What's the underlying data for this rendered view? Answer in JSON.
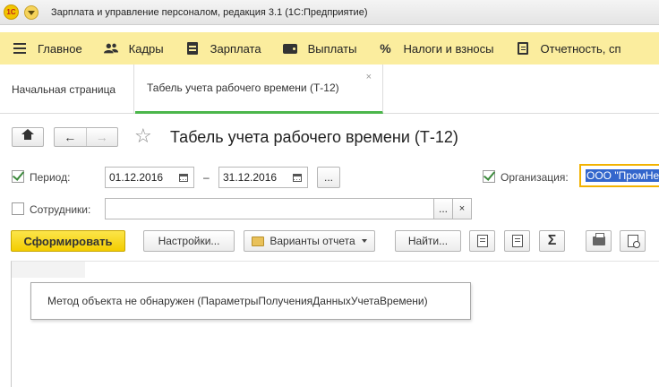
{
  "window": {
    "title": "Зарплата и управление персоналом, редакция 3.1  (1С:Предприятие)",
    "logo_text": "1С"
  },
  "sections": [
    {
      "label": "Главное",
      "icon": "menu-icon"
    },
    {
      "label": "Кадры",
      "icon": "people-icon"
    },
    {
      "label": "Зарплата",
      "icon": "calculator-icon"
    },
    {
      "label": "Выплаты",
      "icon": "wallet-icon"
    },
    {
      "label": "Налоги и взносы",
      "icon": "percent-icon"
    },
    {
      "label": "Отчетность, сп",
      "icon": "reports-icon"
    }
  ],
  "tabs": {
    "home": "Начальная страница",
    "active": "Табель учета рабочего времени (Т-12)",
    "close_glyph": "×"
  },
  "form": {
    "title": "Табель учета рабочего времени (Т-12)",
    "period_label": "Период:",
    "period_from": "01.12.2016",
    "period_dash": "–",
    "period_to": "31.12.2016",
    "ellipsis": "...",
    "organization_label": "Организация:",
    "organization_value": "ООО \"ПромНе",
    "employees_label": "Сотрудники:",
    "employees_value": "",
    "clear_glyph": "×",
    "period_checked": true,
    "organization_checked": true,
    "employees_checked": false
  },
  "commands": {
    "generate": "Сформировать",
    "settings": "Настройки...",
    "variants": "Варианты отчета",
    "find": "Найти...",
    "sum_glyph": "Σ"
  },
  "report": {
    "message": "Метод объекта не обнаружен (ПараметрыПолученияДанныхУчетаВремени)"
  },
  "colors": {
    "section_bar": "#fbed9e",
    "primary_button": "#f3cd00",
    "active_tab_underline": "#4bb64b",
    "organization_focus": "#f2b200"
  }
}
